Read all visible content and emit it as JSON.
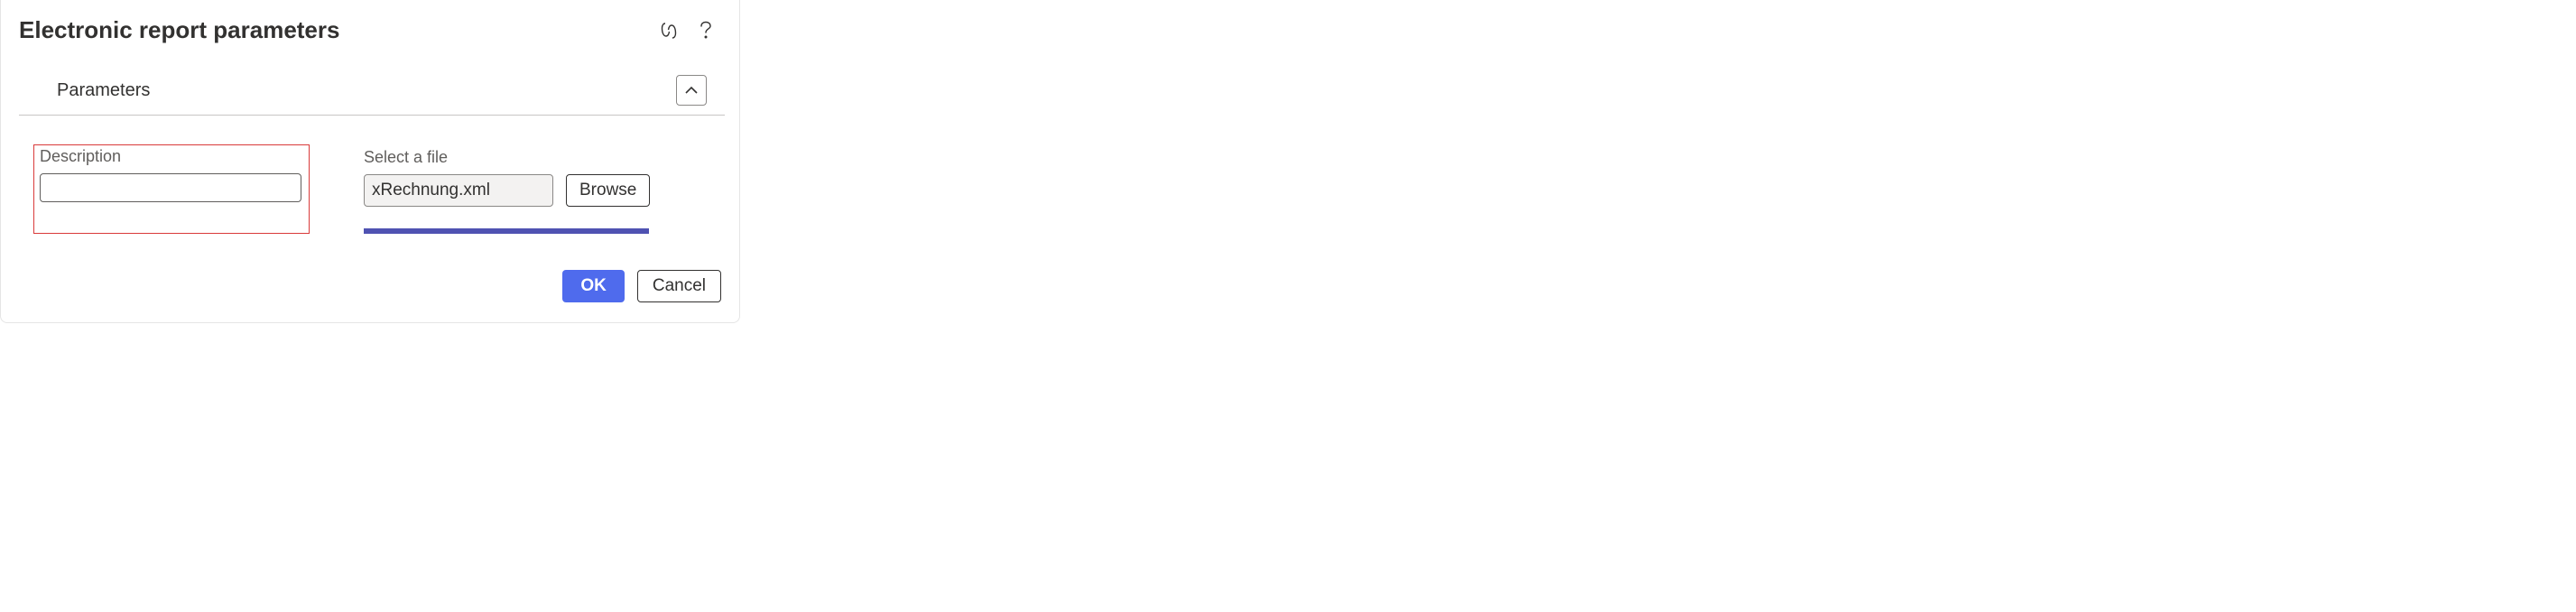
{
  "dialog": {
    "title": "Electronic report parameters"
  },
  "section": {
    "title": "Parameters"
  },
  "fields": {
    "description": {
      "label": "Description",
      "value": ""
    },
    "file": {
      "label": "Select a file",
      "value": "xRechnung.xml",
      "browse_label": "Browse"
    }
  },
  "footer": {
    "ok_label": "OK",
    "cancel_label": "Cancel"
  }
}
